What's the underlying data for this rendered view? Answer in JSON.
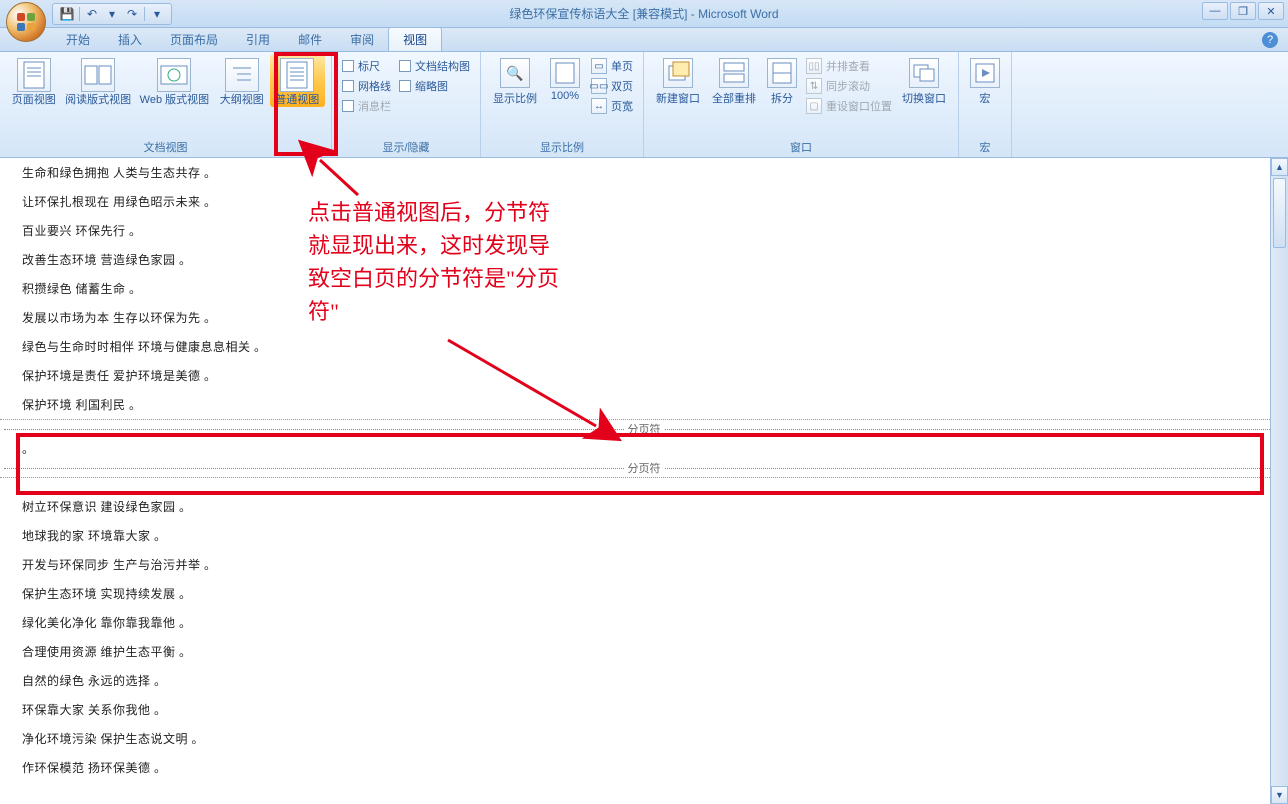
{
  "window": {
    "title": "绿色环保宣传标语大全 [兼容模式] - Microsoft Word",
    "min_icon": "—",
    "max_icon": "❐",
    "close_icon": "✕"
  },
  "qat": {
    "save": "💾",
    "undo": "↶",
    "redo": "↷",
    "dropdown": "▾"
  },
  "tabs": [
    "开始",
    "插入",
    "页面布局",
    "引用",
    "邮件",
    "审阅",
    "视图"
  ],
  "active_tab_index": 6,
  "help_icon": "?",
  "ribbon": {
    "group_view": {
      "label": "文档视图",
      "buttons": [
        {
          "label": "页面视图"
        },
        {
          "label": "阅读版式视图"
        },
        {
          "label": "Web 版式视图"
        },
        {
          "label": "大纲视图"
        },
        {
          "label": "普通视图"
        }
      ]
    },
    "group_show": {
      "label": "显示/隐藏",
      "items": [
        {
          "label": "标尺"
        },
        {
          "label": "网格线"
        },
        {
          "label": "消息栏"
        },
        {
          "label": "文档结构图"
        },
        {
          "label": "缩略图"
        }
      ]
    },
    "group_zoom": {
      "label": "显示比例",
      "zoom_btn": "显示比例",
      "hundred": "100%",
      "rows": [
        "单页",
        "双页",
        "页宽"
      ]
    },
    "group_window": {
      "label": "窗口",
      "new_window": "新建窗口",
      "arrange_all": "全部重排",
      "split": "拆分",
      "side_by_side": "并排查看",
      "sync_scroll": "同步滚动",
      "reset_pos": "重设窗口位置",
      "switch_window": "切换窗口"
    },
    "group_macros": {
      "label": "宏",
      "macros_btn": "宏"
    }
  },
  "document": {
    "lines_before": [
      "生命和绿色拥抱 人类与生态共存 。",
      "让环保扎根现在 用绿色昭示未来 。",
      "百业要兴 环保先行 。",
      "改善生态环境 营造绿色家园 。",
      "积攒绿色 储蓄生命 。",
      "发展以市场为本 生存以环保为先 。",
      "绿色与生命时时相伴 环境与健康息息相关 。",
      "保护环境是责任 爱护环境是美德 。",
      "保护环境 利国利民 。"
    ],
    "page_break_label": "分页符",
    "lines_after": [
      "树立环保意识 建设绿色家园 。",
      "地球我的家 环境靠大家 。",
      "开发与环保同步 生产与治污并举 。",
      "保护生态环境 实现持续发展 。",
      "绿化美化净化 靠你靠我靠他 。",
      "合理使用资源 维护生态平衡 。",
      "自然的绿色 永远的选择 。",
      "环保靠大家 关系你我他 。",
      "净化环境污染 保护生态说文明 。",
      "作环保模范 扬环保美德 。"
    ]
  },
  "annotation": {
    "text": "点击普通视图后，分节符就显现出来，这时发现导致空白页的分节符是\"分页符\""
  }
}
